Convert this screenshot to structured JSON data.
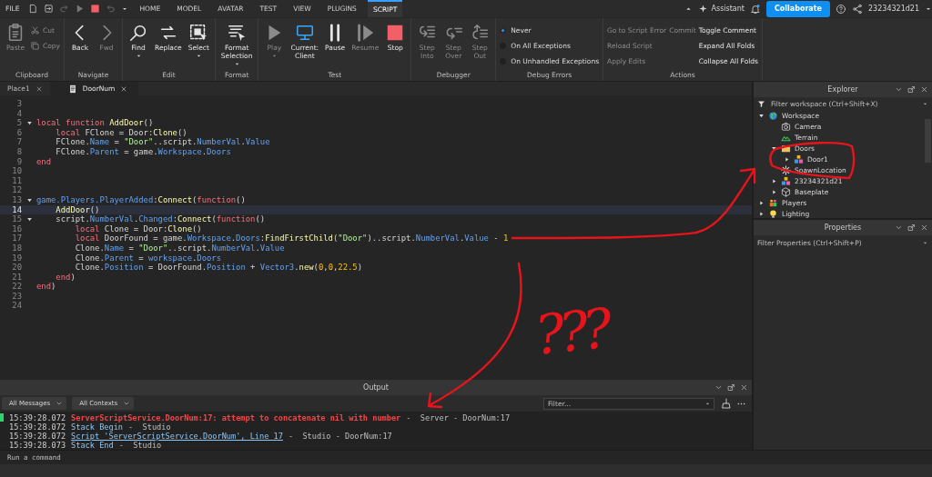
{
  "menubar": {
    "file": "FILE",
    "tabs": [
      {
        "label": "HOME",
        "selected": false
      },
      {
        "label": "MODEL",
        "selected": false
      },
      {
        "label": "AVATAR",
        "selected": false
      },
      {
        "label": "TEST",
        "selected": false
      },
      {
        "label": "VIEW",
        "selected": false
      },
      {
        "label": "PLUGINS",
        "selected": false
      },
      {
        "label": "SCRIPT",
        "selected": true
      }
    ],
    "assistant": "Assistant",
    "collaborate": "Collaborate",
    "user": "23234321d21"
  },
  "ribbon": [
    {
      "label": "Clipboard",
      "columns": [
        [
          {
            "kind": "paste",
            "label": "Paste",
            "disabled": true,
            "menu": false
          }
        ],
        [
          {
            "kind": "cut",
            "label": "Cut",
            "disabled": true
          },
          {
            "kind": "copy",
            "label": "Copy",
            "disabled": true
          }
        ]
      ]
    },
    {
      "label": "Navigate",
      "columns": [
        [
          {
            "kind": "back",
            "label": "Back",
            "disabled": false,
            "menu": false
          }
        ],
        [
          {
            "kind": "fwd",
            "label": "Fwd",
            "disabled": true,
            "menu": false
          }
        ]
      ]
    },
    {
      "label": "Edit",
      "columns": [
        [
          {
            "kind": "find",
            "label": "Find",
            "disabled": false,
            "menu": true
          }
        ],
        [
          {
            "kind": "replace",
            "label": "Replace",
            "disabled": false,
            "menu": false
          }
        ],
        [
          {
            "kind": "select",
            "label": "Select",
            "disabled": false,
            "menu": true
          }
        ]
      ]
    },
    {
      "label": "Format",
      "columns": [
        [
          {
            "kind": "format",
            "label": "Format Selection",
            "disabled": false,
            "menu": true
          }
        ]
      ]
    },
    {
      "label": "Test",
      "columns": [
        [
          {
            "kind": "play",
            "label": "Play",
            "disabled": true,
            "menu": true
          }
        ],
        [
          {
            "kind": "client",
            "label": "Current: Client",
            "disabled": false,
            "menu": false
          }
        ],
        [
          {
            "kind": "pause",
            "label": "Pause",
            "disabled": false,
            "menu": false
          }
        ],
        [
          {
            "kind": "resume",
            "label": "Resume",
            "disabled": true,
            "menu": false
          }
        ],
        [
          {
            "kind": "stop",
            "label": "Stop",
            "disabled": false,
            "menu": false
          }
        ]
      ]
    },
    {
      "label": "Debugger",
      "columns": [
        [
          {
            "kind": "stepinto",
            "label": "Step Into",
            "disabled": true,
            "menu": false
          }
        ],
        [
          {
            "kind": "stepover",
            "label": "Step Over",
            "disabled": true,
            "menu": false
          }
        ],
        [
          {
            "kind": "stepout",
            "label": "Step Out",
            "disabled": true,
            "menu": false
          }
        ]
      ]
    },
    {
      "label": "Debug Errors",
      "columns": [
        [
          {
            "kind": "radio",
            "label": "Never",
            "selected": true
          },
          {
            "kind": "radio",
            "label": "On All Exceptions",
            "selected": false
          },
          {
            "kind": "radio",
            "label": "On Unhandled Exceptions",
            "selected": false
          }
        ]
      ]
    },
    {
      "label": "Actions",
      "columns": [
        [
          {
            "kind": "action",
            "label": "Go to Script Error",
            "disabled": true
          },
          {
            "kind": "action",
            "label": "Reload Script",
            "disabled": true
          },
          {
            "kind": "action",
            "label": "Apply Edits",
            "disabled": true
          }
        ],
        [
          {
            "kind": "action",
            "label": "Commit",
            "disabled": true
          }
        ],
        [
          {
            "kind": "action",
            "label": "Toggle Comment",
            "disabled": false
          },
          {
            "kind": "action",
            "label": "Expand All Folds",
            "disabled": false
          },
          {
            "kind": "action",
            "label": "Collapse All Folds",
            "disabled": false
          }
        ]
      ]
    }
  ],
  "editor": {
    "tabs": [
      {
        "label": "Place1",
        "kind": "place",
        "selected": false
      },
      {
        "label": "DoorNum",
        "kind": "script",
        "selected": true
      }
    ],
    "lines": [
      {
        "n": "3",
        "foldable": false,
        "current": false
      },
      {
        "n": "4",
        "foldable": false,
        "current": false
      },
      {
        "n": "5",
        "foldable": true,
        "current": false,
        "tokens": [
          {
            "kind": "keyword",
            "t": "local function "
          },
          {
            "kind": "function",
            "t": "AddDoor"
          },
          {
            "kind": "plain",
            "t": "()"
          }
        ]
      },
      {
        "n": "6",
        "foldable": false,
        "current": false,
        "tokens": [
          {
            "kind": "keyword",
            "t": "    local"
          },
          {
            "kind": "plain",
            "t": " FClone = Door:"
          },
          {
            "kind": "function",
            "t": "Clone"
          },
          {
            "kind": "plain",
            "t": "()"
          }
        ]
      },
      {
        "n": "7",
        "foldable": false,
        "current": false,
        "tokens": [
          {
            "kind": "plain",
            "t": "    FClone."
          },
          {
            "kind": "property",
            "t": "Name"
          },
          {
            "kind": "plain",
            "t": " = "
          },
          {
            "kind": "string",
            "t": "\"Door\""
          },
          {
            "kind": "plain",
            "t": "..script."
          },
          {
            "kind": "property",
            "t": "NumberVal"
          },
          {
            "kind": "plain",
            "t": "."
          },
          {
            "kind": "property",
            "t": "Value"
          }
        ]
      },
      {
        "n": "8",
        "foldable": false,
        "current": false,
        "tokens": [
          {
            "kind": "plain",
            "t": "    FClone."
          },
          {
            "kind": "property",
            "t": "Parent"
          },
          {
            "kind": "plain",
            "t": " = game."
          },
          {
            "kind": "property",
            "t": "Workspace"
          },
          {
            "kind": "plain",
            "t": "."
          },
          {
            "kind": "property",
            "t": "Doors"
          }
        ]
      },
      {
        "n": "9",
        "foldable": false,
        "current": false,
        "tokens": [
          {
            "kind": "keyword",
            "t": "end"
          }
        ]
      },
      {
        "n": "10",
        "foldable": false,
        "current": false
      },
      {
        "n": "11",
        "foldable": false,
        "current": false
      },
      {
        "n": "12",
        "foldable": false,
        "current": false
      },
      {
        "n": "13",
        "foldable": true,
        "current": false,
        "tokens": [
          {
            "kind": "property",
            "t": "game.Players.PlayerAdded"
          },
          {
            "kind": "plain",
            "t": ":"
          },
          {
            "kind": "function",
            "t": "Connect"
          },
          {
            "kind": "plain",
            "t": "("
          },
          {
            "kind": "keyword",
            "t": "function"
          },
          {
            "kind": "plain",
            "t": "()"
          }
        ]
      },
      {
        "n": "14",
        "foldable": false,
        "current": true,
        "tokens": [
          {
            "kind": "function",
            "t": "    AddDoor"
          },
          {
            "kind": "plain",
            "t": "()"
          }
        ]
      },
      {
        "n": "15",
        "foldable": true,
        "current": false,
        "tokens": [
          {
            "kind": "plain",
            "t": "    script."
          },
          {
            "kind": "property",
            "t": "NumberVal"
          },
          {
            "kind": "plain",
            "t": "."
          },
          {
            "kind": "property",
            "t": "Changed"
          },
          {
            "kind": "plain",
            "t": ":"
          },
          {
            "kind": "function",
            "t": "Connect"
          },
          {
            "kind": "plain",
            "t": "("
          },
          {
            "kind": "keyword",
            "t": "function"
          },
          {
            "kind": "plain",
            "t": "()"
          }
        ]
      },
      {
        "n": "16",
        "foldable": false,
        "current": false,
        "tokens": [
          {
            "kind": "keyword",
            "t": "        local"
          },
          {
            "kind": "plain",
            "t": " Clone = Door:"
          },
          {
            "kind": "function",
            "t": "Clone"
          },
          {
            "kind": "plain",
            "t": "()"
          }
        ]
      },
      {
        "n": "17",
        "foldable": false,
        "current": false,
        "tokens": [
          {
            "kind": "keyword",
            "t": "        local"
          },
          {
            "kind": "plain",
            "t": " DoorFound = game."
          },
          {
            "kind": "property",
            "t": "Workspace"
          },
          {
            "kind": "plain",
            "t": "."
          },
          {
            "kind": "property",
            "t": "Doors"
          },
          {
            "kind": "plain",
            "t": ":"
          },
          {
            "kind": "function",
            "t": "FindFirstChild"
          },
          {
            "kind": "plain",
            "t": "("
          },
          {
            "kind": "string",
            "t": "\"Door\""
          },
          {
            "kind": "plain",
            "t": ")..script."
          },
          {
            "kind": "property",
            "t": "NumberVal"
          },
          {
            "kind": "plain",
            "t": "."
          },
          {
            "kind": "property",
            "t": "Value"
          },
          {
            "kind": "plain",
            "t": " - "
          },
          {
            "kind": "number",
            "t": "1"
          }
        ]
      },
      {
        "n": "18",
        "foldable": false,
        "current": false,
        "tokens": [
          {
            "kind": "plain",
            "t": "        Clone."
          },
          {
            "kind": "property",
            "t": "Name"
          },
          {
            "kind": "plain",
            "t": " = "
          },
          {
            "kind": "string",
            "t": "\"Door\""
          },
          {
            "kind": "plain",
            "t": "..script."
          },
          {
            "kind": "property",
            "t": "NumberVal"
          },
          {
            "kind": "plain",
            "t": "."
          },
          {
            "kind": "property",
            "t": "Value"
          }
        ]
      },
      {
        "n": "19",
        "foldable": false,
        "current": false,
        "tokens": [
          {
            "kind": "plain",
            "t": "        Clone."
          },
          {
            "kind": "property",
            "t": "Parent"
          },
          {
            "kind": "plain",
            "t": " = "
          },
          {
            "kind": "property",
            "t": "workspace"
          },
          {
            "kind": "plain",
            "t": "."
          },
          {
            "kind": "property",
            "t": "Doors"
          }
        ]
      },
      {
        "n": "20",
        "foldable": false,
        "current": false,
        "tokens": [
          {
            "kind": "plain",
            "t": "        Clone."
          },
          {
            "kind": "property",
            "t": "Position"
          },
          {
            "kind": "plain",
            "t": " = DoorFound."
          },
          {
            "kind": "property",
            "t": "Position"
          },
          {
            "kind": "plain",
            "t": " + "
          },
          {
            "kind": "property",
            "t": "Vector3"
          },
          {
            "kind": "plain",
            "t": "."
          },
          {
            "kind": "function",
            "t": "new"
          },
          {
            "kind": "plain",
            "t": "("
          },
          {
            "kind": "number",
            "t": "0"
          },
          {
            "kind": "plain",
            "t": ","
          },
          {
            "kind": "number",
            "t": "0"
          },
          {
            "kind": "plain",
            "t": ","
          },
          {
            "kind": "number",
            "t": "22.5"
          },
          {
            "kind": "plain",
            "t": ")"
          }
        ]
      },
      {
        "n": "21",
        "foldable": false,
        "current": false,
        "tokens": [
          {
            "kind": "keyword",
            "t": "    end"
          },
          {
            "kind": "plain",
            "t": ")"
          }
        ]
      },
      {
        "n": "22",
        "foldable": false,
        "current": false,
        "tokens": [
          {
            "kind": "keyword",
            "t": "end"
          },
          {
            "kind": "plain",
            "t": ")"
          }
        ]
      },
      {
        "n": "23",
        "foldable": false,
        "current": false
      },
      {
        "n": "24",
        "foldable": false,
        "current": false
      }
    ]
  },
  "output": {
    "title": "Output",
    "filters": [
      "All Messages",
      "All Contexts"
    ],
    "filter_placeholder": "Filter...",
    "log": [
      {
        "time": "15:39:28.072",
        "kind": "error",
        "flagged": true,
        "message": "ServerScriptService.DoorNum:17: attempt to concatenate nil with number",
        "source": "-  Server - DoorNum:17"
      },
      {
        "time": "15:39:28.072",
        "kind": "info",
        "flagged": false,
        "message": "Stack Begin",
        "source": "-  Studio"
      },
      {
        "time": "15:39:28.072",
        "kind": "link",
        "flagged": false,
        "message": "Script 'ServerScriptService.DoorNum', Line 17",
        "source": "-  Studio - DoorNum:17"
      },
      {
        "time": "15:39:28.073",
        "kind": "info",
        "flagged": false,
        "message": "Stack End",
        "source": "-  Studio"
      }
    ]
  },
  "explorer": {
    "title": "Explorer",
    "filter_placeholder": "Filter workspace (Ctrl+Shift+X)",
    "tree": [
      {
        "label": "Workspace",
        "kind": "workspace",
        "expanded": true,
        "children": [
          {
            "label": "Camera",
            "kind": "camera"
          },
          {
            "label": "Terrain",
            "kind": "terrain"
          },
          {
            "label": "Doors",
            "kind": "folder",
            "expanded": true,
            "children": [
              {
                "label": "Door1",
                "kind": "model",
                "expanded": false
              }
            ]
          },
          {
            "label": "SpawnLocation",
            "kind": "spawn"
          },
          {
            "label": "23234321d21",
            "kind": "model",
            "expanded": false
          },
          {
            "label": "Baseplate",
            "kind": "part",
            "expanded": false
          }
        ]
      },
      {
        "label": "Players",
        "kind": "players",
        "expanded": false
      },
      {
        "label": "Lighting",
        "kind": "lighting",
        "expanded": false
      }
    ]
  },
  "properties": {
    "title": "Properties",
    "filter_placeholder": "Filter Properties (Ctrl+Shift+P)"
  },
  "command_bar": {
    "placeholder": "Run a command"
  },
  "annotation": {
    "note": "???"
  }
}
